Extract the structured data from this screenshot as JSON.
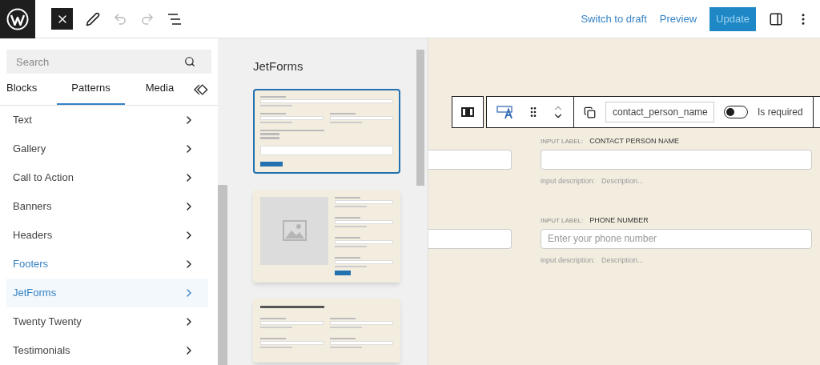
{
  "top_bar": {
    "actions": [
      {
        "label": "Switch to draft",
        "kind": "link"
      },
      {
        "label": "Preview",
        "kind": "link"
      },
      {
        "label": "Update",
        "kind": "primary"
      }
    ]
  },
  "sidebar": {
    "search": {
      "placeholder": "Search"
    },
    "tabs": [
      {
        "label": "Blocks",
        "selected": false
      },
      {
        "label": "Patterns",
        "selected": true
      },
      {
        "label": "Media",
        "selected": false
      }
    ],
    "categories": [
      {
        "label": "Text",
        "selected": false,
        "highlighted": false
      },
      {
        "label": "Gallery",
        "selected": false,
        "highlighted": false
      },
      {
        "label": "Call to Action",
        "selected": false,
        "highlighted": false
      },
      {
        "label": "Banners",
        "selected": false,
        "highlighted": false
      },
      {
        "label": "Headers",
        "selected": false,
        "highlighted": false
      },
      {
        "label": "Footers",
        "selected": false,
        "highlighted": true
      },
      {
        "label": "JetForms",
        "selected": true,
        "highlighted": false
      },
      {
        "label": "Twenty Twenty",
        "selected": false,
        "highlighted": false
      },
      {
        "label": "Testimonials",
        "selected": false,
        "highlighted": false
      }
    ]
  },
  "patterns": {
    "title": "JetForms",
    "previews": [
      {
        "kind": "form",
        "selected": true
      },
      {
        "kind": "image-form",
        "selected": false
      },
      {
        "kind": "grid-form",
        "selected": false
      }
    ]
  },
  "block_toolbar": {
    "field_name": "contact_person_name",
    "required": {
      "label": "Is required",
      "on": false
    }
  },
  "form": {
    "fields": [
      {
        "label_prefix": "INPUT LABEL:",
        "label": "CONTACT PERSON NAME",
        "description_prefix": "input description:",
        "description": "Description..."
      },
      {
        "label_prefix": "INPUT LABEL:",
        "label": "PHONE NUMBER",
        "placeholder": "Enter your phone number",
        "description_prefix": "input description:",
        "description": "Description..."
      }
    ]
  }
}
